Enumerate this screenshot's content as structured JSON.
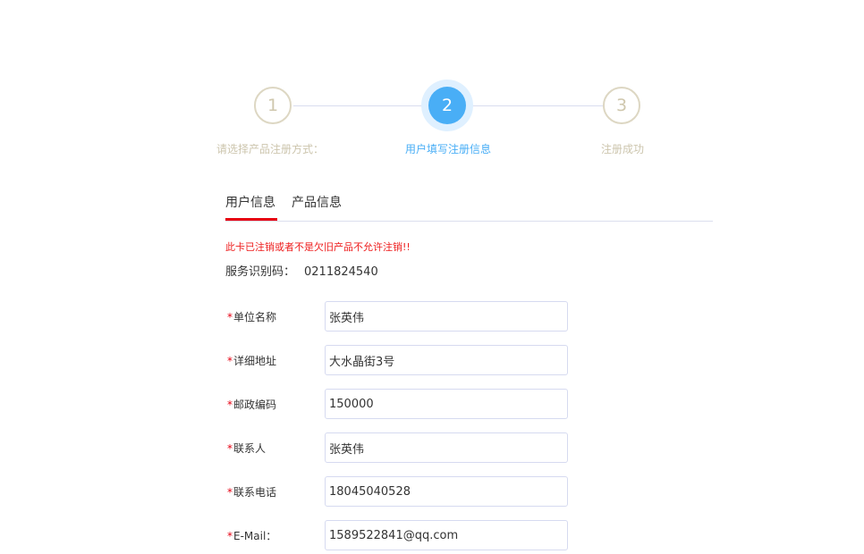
{
  "stepper": {
    "steps": [
      {
        "number": "1",
        "label": "请选择产品注册方式：",
        "state": "inactive"
      },
      {
        "number": "2",
        "label": "用户填写注册信息",
        "state": "active"
      },
      {
        "number": "3",
        "label": "注册成功",
        "state": "inactive"
      }
    ],
    "colors": {
      "active": "#49aef6",
      "inactive": "#ccc5ad",
      "line": "#d9dcef"
    }
  },
  "tabs": [
    {
      "label": "用户信息",
      "active": true
    },
    {
      "label": "产品信息",
      "active": false
    }
  ],
  "warning_text": "此卡已注销或者不是欠旧产品不允许注销!!",
  "service": {
    "label": "服务识别码：",
    "value": "0211824540"
  },
  "form": {
    "required_mark": "*",
    "fields": [
      {
        "label": "单位名称",
        "value": "张英伟"
      },
      {
        "label": "详细地址",
        "value": "大水晶街3号"
      },
      {
        "label": "邮政编码",
        "value": "150000"
      },
      {
        "label": "联系人",
        "value": "张英伟"
      },
      {
        "label": "联系电话",
        "value": "18045040528"
      },
      {
        "label": "E-Mail：",
        "value": "1589522841@qq.com"
      }
    ]
  },
  "colors": {
    "accent_red": "#e60012",
    "warning_red": "#ee1c1c",
    "input_border": "#d6daf0"
  }
}
